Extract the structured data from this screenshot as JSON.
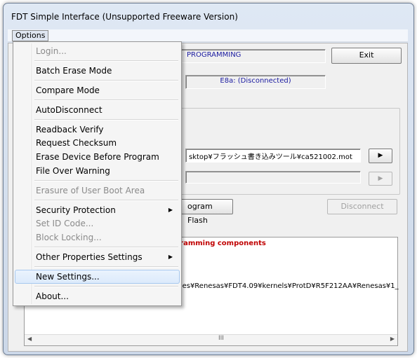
{
  "window": {
    "title": "FDT Simple Interface   (Unsupported Freeware Version)"
  },
  "menubar": {
    "options_label": "Options"
  },
  "main": {
    "mode_text": "PROGRAMMING",
    "exit_label": "Exit",
    "device_status": "E8a: (Disconnected)",
    "file_path": "sktop¥フラッシュ書き込みツール¥ca521002.mot",
    "browse1_label": "▶",
    "browse2_label": "▶",
    "program_flash_label": "ogram Flash",
    "disconnect_label": "Disconnect"
  },
  "log": {
    "line1": "gramming components",
    "line2": "Files¥Renesas¥FDT4.09¥kernels¥ProtD¥R5F212AA¥Renesas¥1_"
  },
  "scroll": {
    "left_arrow": "◀",
    "right_arrow": "▶",
    "grip": "III"
  },
  "menu": {
    "items": [
      {
        "label": "Login...",
        "disabled": true
      },
      {
        "label": "Batch Erase Mode"
      },
      {
        "label": "Compare Mode"
      },
      {
        "label": "AutoDisconnect"
      },
      {
        "label": "Readback Verify"
      },
      {
        "label": "Request Checksum"
      },
      {
        "label": "Erase Device Before Program"
      },
      {
        "label": "File Over Warning"
      },
      {
        "label": "Erasure of User Boot Area",
        "disabled": true
      },
      {
        "label": "Security Protection",
        "submenu": true
      },
      {
        "label": "Set ID Code...",
        "disabled": true
      },
      {
        "label": "Block Locking...",
        "disabled": true
      },
      {
        "label": "Other Properties Settings",
        "submenu": true
      },
      {
        "label": "New Settings...",
        "highlighted": true
      },
      {
        "label": "About..."
      }
    ],
    "submenu_arrow": "▶"
  },
  "colors": {
    "log_highlight": "#c00000",
    "mode_text": "#1a1aa0",
    "status_text": "#1a1aa0",
    "menu_highlight": "#dceafb"
  }
}
